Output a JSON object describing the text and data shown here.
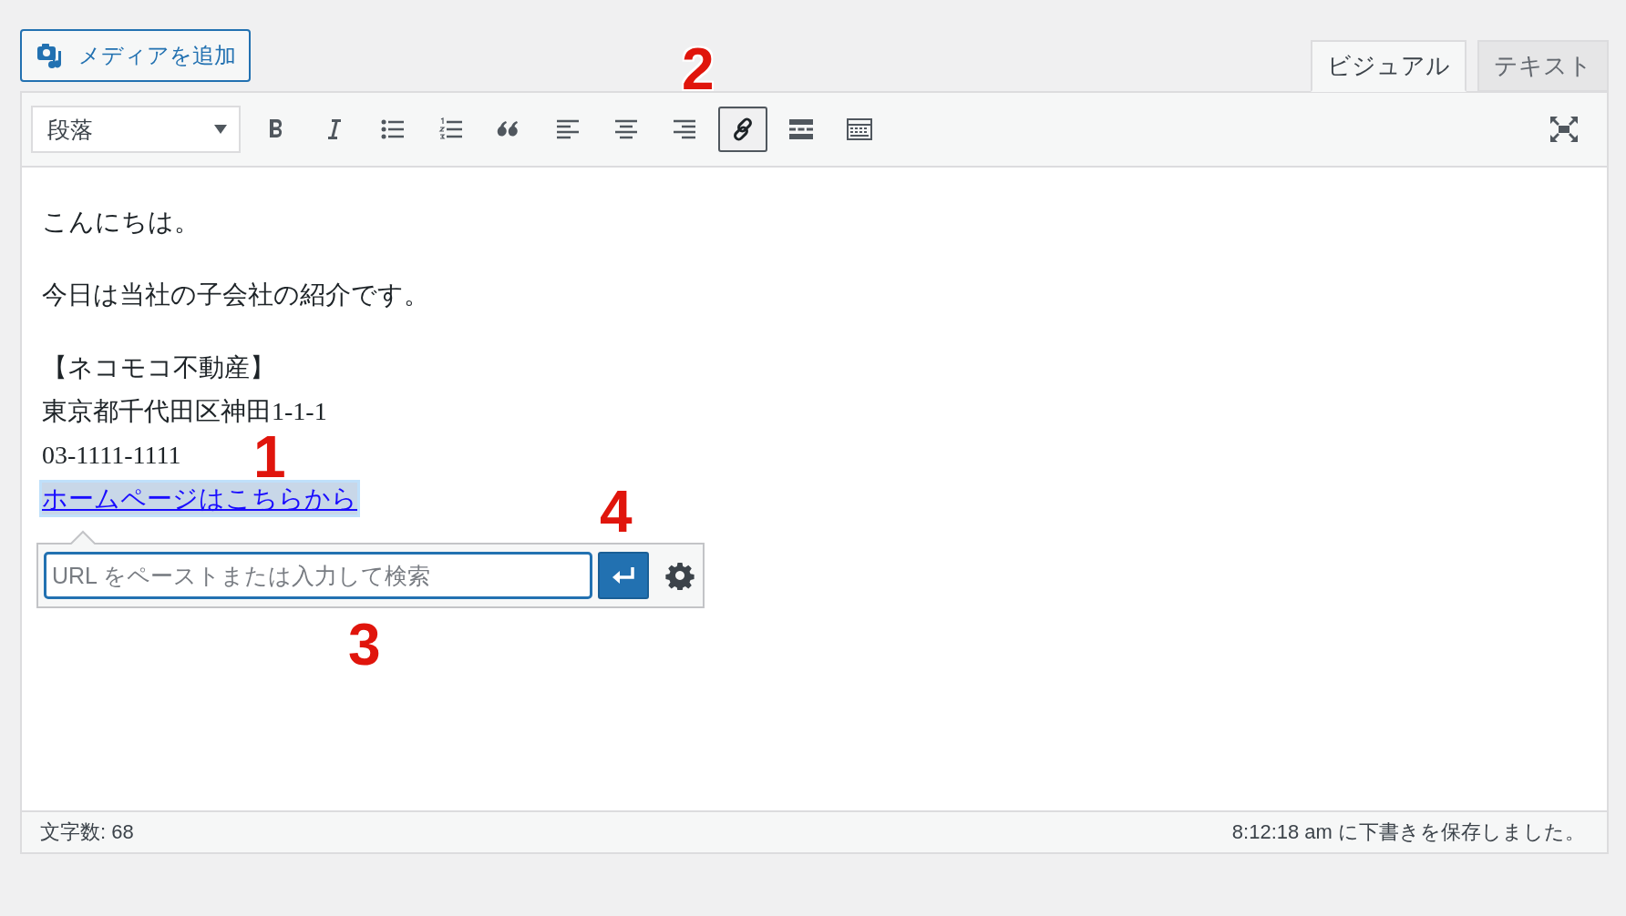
{
  "media_button": {
    "label": "メディアを追加"
  },
  "tabs": [
    {
      "label": "ビジュアル",
      "selected": true
    },
    {
      "label": "テキスト",
      "selected": false
    }
  ],
  "toolbar": {
    "format_select": {
      "value": "段落"
    },
    "buttons": [
      {
        "kind": "bold",
        "selected": false
      },
      {
        "kind": "italic",
        "selected": false
      },
      {
        "kind": "bullet-list",
        "selected": false
      },
      {
        "kind": "numbered-list",
        "selected": false
      },
      {
        "kind": "blockquote",
        "selected": false
      },
      {
        "kind": "align-left",
        "selected": false
      },
      {
        "kind": "align-center",
        "selected": false
      },
      {
        "kind": "align-right",
        "selected": false
      },
      {
        "kind": "link",
        "selected": true
      },
      {
        "kind": "read-more",
        "selected": false
      },
      {
        "kind": "toolbar-toggle",
        "selected": false
      }
    ],
    "end_buttons": [
      {
        "kind": "fullscreen"
      }
    ]
  },
  "content": {
    "paragraphs": [
      {
        "lines": [
          {
            "kind": "text",
            "text": "こんにちは。"
          }
        ]
      },
      {
        "lines": [
          {
            "kind": "text",
            "text": "今日は当社の子会社の紹介です。"
          }
        ]
      },
      {
        "lines": [
          {
            "kind": "text",
            "text": "【ネコモコ不動産】"
          },
          {
            "kind": "text",
            "text": "東京都千代田区神田1-1-1"
          },
          {
            "kind": "text",
            "text": "03-1111-1111"
          },
          {
            "kind": "link",
            "text": "ホームページはこちらから",
            "selected": true
          }
        ]
      }
    ]
  },
  "link_popup": {
    "placeholder": "URL をペーストまたは入力して検索"
  },
  "status_bar": {
    "word_count": "文字数: 68",
    "save_status": "8:12:18 am に下書きを保存しました。"
  },
  "annotations": [
    {
      "label": "1"
    },
    {
      "label": "2"
    },
    {
      "label": "3"
    },
    {
      "label": "4"
    }
  ]
}
